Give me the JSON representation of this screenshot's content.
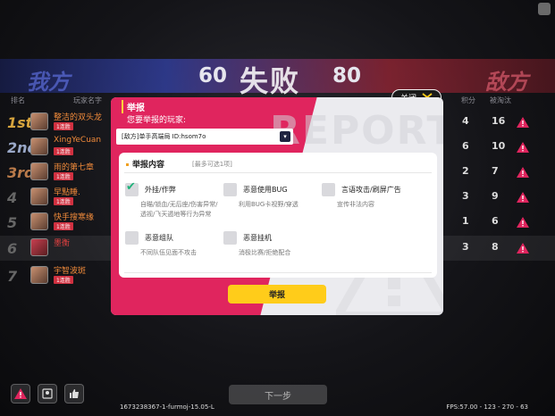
{
  "scoreboard": {
    "team_left": "我方",
    "team_right": "敌方",
    "score_left": "60",
    "score_right": "80",
    "result": "失败",
    "headers": [
      "排名",
      "玩家名字",
      "积分",
      "被淘汰"
    ],
    "rows": [
      {
        "rank": "1st",
        "name": "整洁的双头龙",
        "tag": "1连胜",
        "score": "4",
        "elim": "16"
      },
      {
        "rank": "2nd",
        "name": "XingYeCuan",
        "tag": "1连胜",
        "score": "6",
        "elim": "10"
      },
      {
        "rank": "3rd",
        "name": "雨的第七章",
        "tag": "1连胜",
        "score": "2",
        "elim": "7"
      },
      {
        "rank": "4",
        "name": "早點睡.",
        "tag": "1连胜",
        "score": "3",
        "elim": "9"
      },
      {
        "rank": "5",
        "name": "快手搜寒缘",
        "tag": "1连胜",
        "score": "1",
        "elim": "6"
      },
      {
        "rank": "6",
        "name": "墨衡",
        "tag": "",
        "score": "3",
        "elim": "8"
      },
      {
        "rank": "7",
        "name": "宇智波斑",
        "tag": "1连胜",
        "score": "",
        "elim": ""
      }
    ]
  },
  "close_label": "关闭",
  "dialog": {
    "title": "举报",
    "subtitle": "您要举报的玩家:",
    "selected_player": "[敌方]单手高端局 ID:hsom7o",
    "watermark": "REPORT",
    "panel_title": "举报内容",
    "panel_hint": "[最多可选1项]",
    "options": [
      {
        "label": "外挂/作弊",
        "desc": "自瞄/锁血/无后座/伤害异常/透视/飞天遁地等行为异常",
        "checked": true
      },
      {
        "label": "恶意使用BUG",
        "desc": "利用BUG卡视野/穿透",
        "checked": false
      },
      {
        "label": "言语攻击/刷屏广告",
        "desc": "宣传非法内容",
        "checked": false
      },
      {
        "label": "恶意组队",
        "desc": "不同队伍见面不攻击",
        "checked": false
      },
      {
        "label": "恶意挂机",
        "desc": "消极比赛/拒绝配合",
        "checked": false
      }
    ],
    "submit_label": "举报"
  },
  "bottom": {
    "next_label": "下一步",
    "build": "1673238367-1-furmoj-15.05-L",
    "fps": "FPS:57.00 - 123 - 270 - 63"
  },
  "colors": {
    "accent_pink": "#e0255e",
    "submit_yellow": "#ffcc1a",
    "check_green": "#1fb27a"
  }
}
